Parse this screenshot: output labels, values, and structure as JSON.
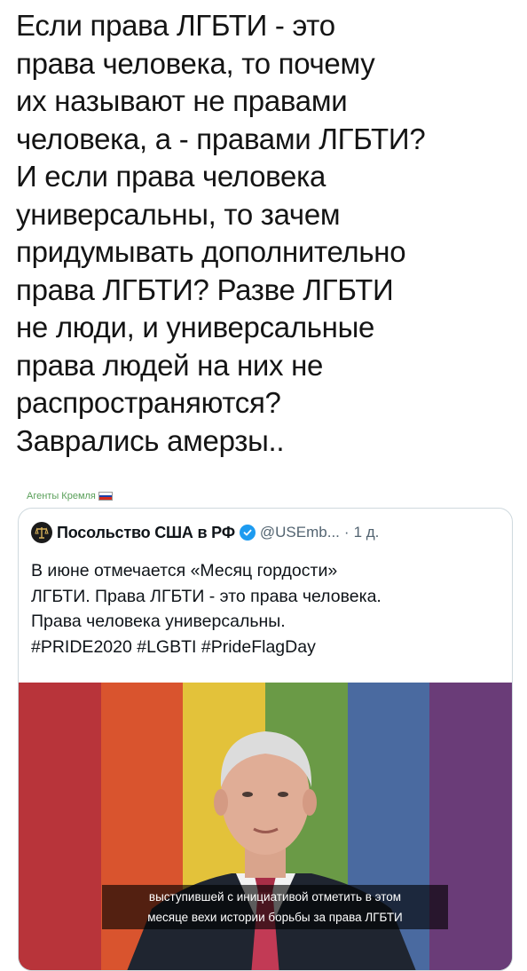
{
  "post": {
    "lines": [
      "Если права ЛГБТИ - это",
      "права человека, то почему",
      "их называют не правами",
      "человека, а - правами ЛГБТИ?",
      "И если права человека",
      "универсальны, то зачем",
      "придумывать дополнительно",
      "права ЛГБТИ? Разве ЛГБТИ",
      "не люди, и универсальные",
      "права людей на них не",
      "распространяются?",
      "Заврались амерзы.."
    ]
  },
  "watermark": {
    "text": "Агенты Кремля",
    "flag_colors": [
      "#ffffff",
      "#1c3fa8",
      "#d52b1e"
    ]
  },
  "quoted_tweet": {
    "avatar_icon": "scales-of-justice-icon",
    "author": "Посольство США в РФ",
    "verified_icon": "verified-check-icon",
    "handle": "@USEmb...",
    "separator": "·",
    "time": "1 д.",
    "text_lines": [
      "В июне отмечается «Месяц гордости»",
      "ЛГБТИ. Права ЛГБТИ - это права человека.",
      "Права человека универсальны.",
      "#PRIDE2020 #LGBTI #PrideFlagDay"
    ],
    "media": {
      "stripe_colors": [
        "#b8343a",
        "#d9542e",
        "#e3c23a",
        "#6a9a46",
        "#4a6aa0",
        "#6a3c78"
      ],
      "subtitle_lines": [
        "выступившей с инициативой отметить в этом",
        "месяце вехи истории борьбы за права ЛГБТИ"
      ]
    }
  },
  "colors": {
    "accent": "#1d9bf0",
    "secondary_text": "#536471",
    "watermark": "#5aa05a"
  }
}
